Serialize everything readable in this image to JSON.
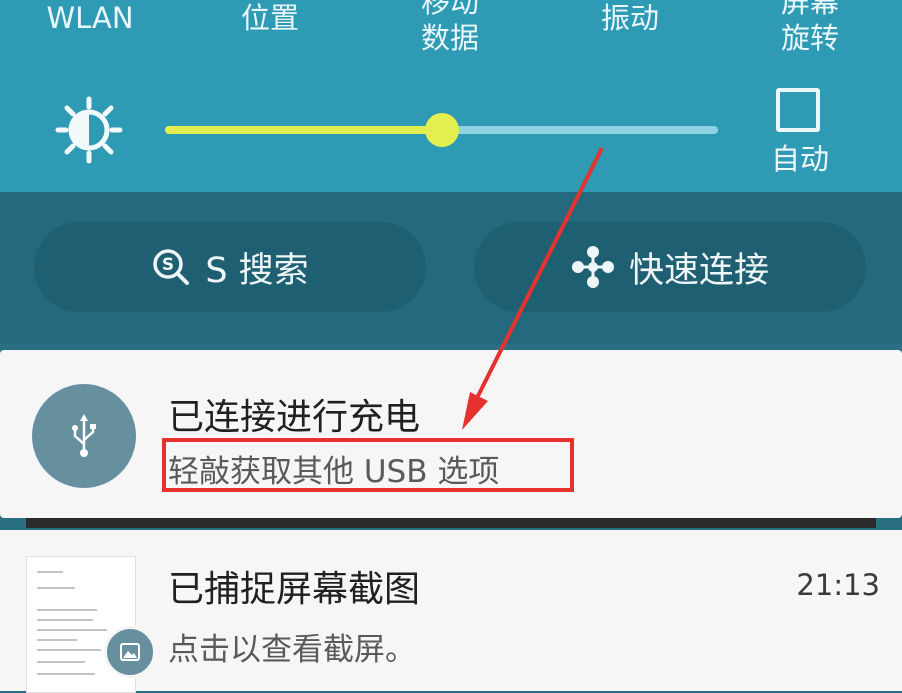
{
  "quick_settings": {
    "toggles": [
      {
        "lines": [
          "WLAN"
        ]
      },
      {
        "lines": [
          "位置"
        ]
      },
      {
        "lines": [
          "移动",
          "数据"
        ]
      },
      {
        "lines": [
          "振动"
        ]
      },
      {
        "lines": [
          "屏幕",
          "旋转"
        ]
      }
    ],
    "brightness": {
      "level": 0.5,
      "auto_label": "自动",
      "auto_checked": false
    }
  },
  "buttons": {
    "search_label": "S 搜索",
    "connect_label": "快速连接"
  },
  "notifications": [
    {
      "title": "已连接进行充电",
      "subtitle": "轻敲获取其他 USB 选项",
      "icon": "usb-icon"
    },
    {
      "title": "已捕捉屏幕截图",
      "subtitle": "点击以查看截屏。",
      "time": "21:13",
      "icon": "gallery-icon"
    }
  ],
  "colors": {
    "panel": "#2e9ab4",
    "slider_active": "#e3ef4f",
    "highlight": "#e5322f"
  }
}
